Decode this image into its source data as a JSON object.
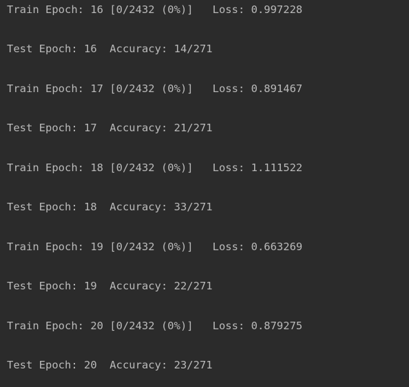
{
  "console": {
    "text_color": "#bababa",
    "background": "#2b2b2b",
    "lines": [
      "Train Epoch: 16 [0/2432 (0%)]   Loss: 0.997228",
      "Test Epoch: 16  Accuracy: 14/271",
      "Train Epoch: 17 [0/2432 (0%)]   Loss: 0.891467",
      "Test Epoch: 17  Accuracy: 21/271",
      "Train Epoch: 18 [0/2432 (0%)]   Loss: 1.111522",
      "Test Epoch: 18  Accuracy: 33/271",
      "Train Epoch: 19 [0/2432 (0%)]   Loss: 0.663269",
      "Test Epoch: 19  Accuracy: 22/271",
      "Train Epoch: 20 [0/2432 (0%)]   Loss: 0.879275",
      "Test Epoch: 20  Accuracy: 23/271"
    ]
  }
}
